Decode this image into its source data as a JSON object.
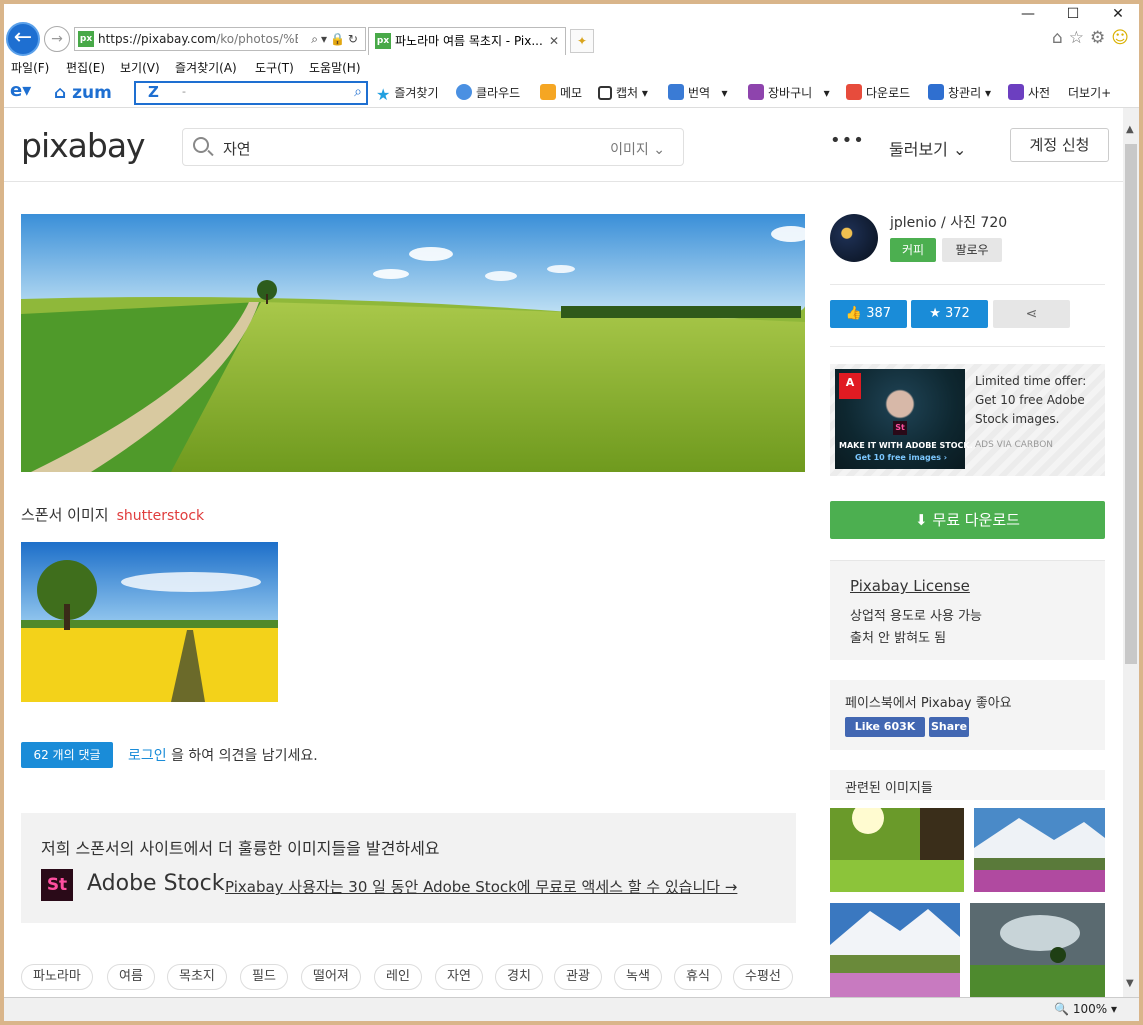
{
  "browser": {
    "url_host": "https://pixabay.com",
    "url_path": "/ko/photos/%ED",
    "tab_title": "파노라마 여름 목초지 - Pix...",
    "favicon_text": "px",
    "window_controls": [
      "—",
      "☐",
      "✕"
    ],
    "menu": [
      "파일(F)",
      "편집(E)",
      "보기(V)",
      "즐겨찾기(A)",
      "도구(T)",
      "도움말(H)"
    ],
    "toolbar": {
      "zum": "zum",
      "search_placeholder": "-",
      "items": [
        "즐겨찾기",
        "클라우드",
        "메모",
        "캡처",
        "번역",
        "장바구니",
        "다운로드",
        "창관리",
        "사전",
        "더보기+"
      ]
    },
    "zoom": "100%"
  },
  "header": {
    "logo": "pixabay",
    "search_value": "자연",
    "search_category": "이미지",
    "more": "•••",
    "browse": "둘러보기",
    "signup": "계정 신청"
  },
  "sponsor": {
    "label": "스폰서 이미지",
    "brand": "shutterstock"
  },
  "comments": {
    "count_label": "62 개의 댓글",
    "login_link": "로그인",
    "login_rest": "을 하여 의견을 남기세요."
  },
  "adobe": {
    "heading": "저희 스폰서의 사이트에서 더 훌륭한 이미지들을 발견하세요",
    "logo": "St",
    "name": "Adobe Stock",
    "link": "Pixabay 사용자는 30 일 동안 Adobe Stock에 무료로 액세스 할 수 있습니다 →"
  },
  "tags": [
    "파노라마",
    "여름",
    "목초지",
    "필드",
    "떨어져",
    "레인",
    "자연",
    "경치",
    "관광",
    "녹색",
    "휴식",
    "수평선"
  ],
  "author": {
    "name": "jplenio / 사진 720",
    "coffee": "커피",
    "follow": "팔로우"
  },
  "stats": {
    "likes": "387",
    "favorites": "372"
  },
  "carbon": {
    "badge": "A",
    "img_st": "St",
    "img_line1": "MAKE IT WITH ADOBE STOCK.",
    "img_line2": "Get 10 free images ›",
    "text": "Limited time offer: Get 10 free Adobe Stock images.",
    "via": "ADS VIA CARBON"
  },
  "download": "무료 다운로드",
  "license": {
    "title": "Pixabay License",
    "line1": "상업적 용도로 사용 가능",
    "line2": "출처 안 밝혀도 됨"
  },
  "facebook": {
    "title": "페이스북에서 Pixabay 좋아요",
    "like": "Like 603K",
    "share": "Share"
  },
  "related": {
    "title": "관련된 이미지들"
  }
}
